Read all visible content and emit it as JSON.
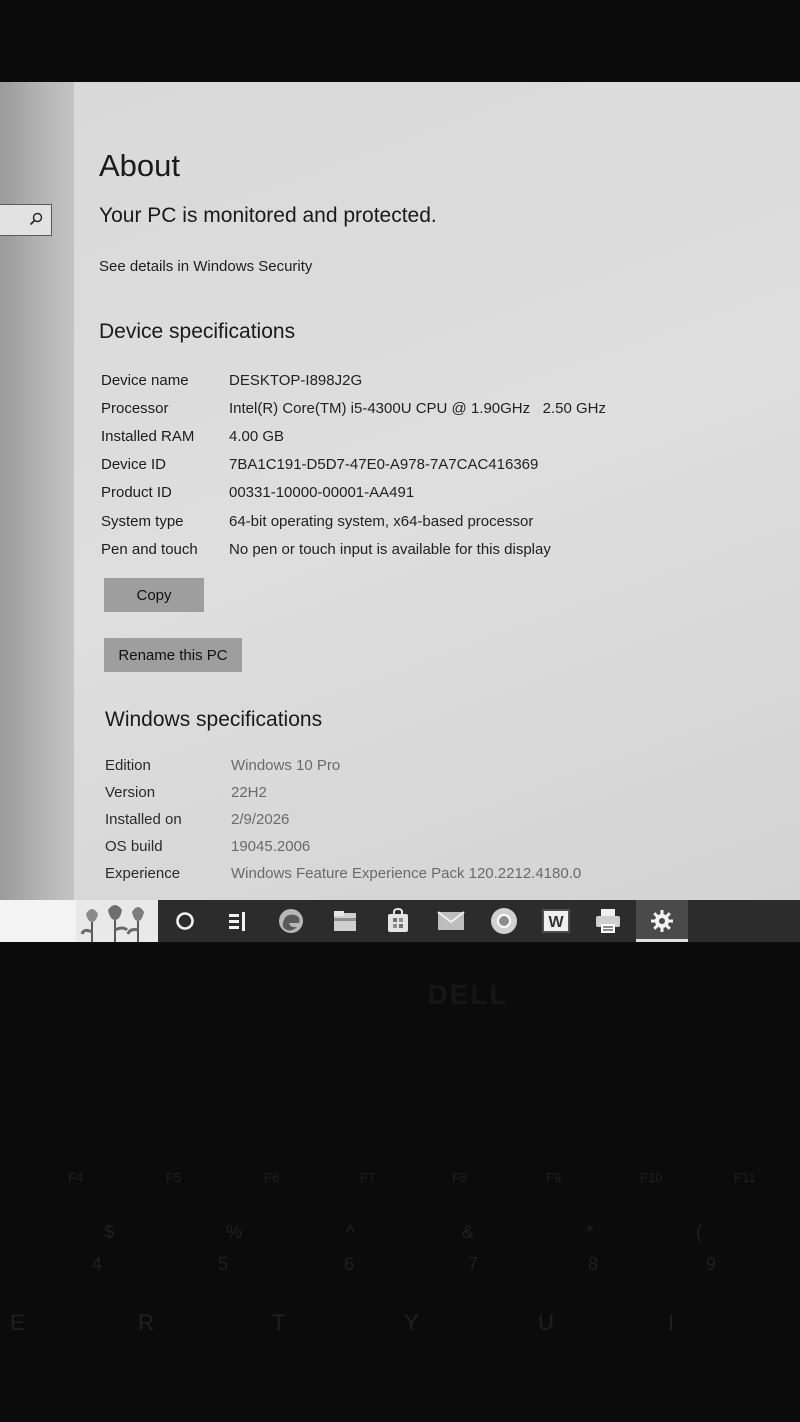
{
  "about": {
    "title": "About",
    "protection_status": "Your PC is monitored and protected.",
    "security_link": "See details in Windows Security"
  },
  "device_specs": {
    "heading": "Device specifications",
    "rows": [
      {
        "label": "Device name",
        "value": "DESKTOP-I898J2G"
      },
      {
        "label": "Processor",
        "value": "Intel(R) Core(TM) i5-4300U CPU @ 1.90GHz   2.50 GHz"
      },
      {
        "label": "Installed RAM",
        "value": "4.00 GB"
      },
      {
        "label": "Device ID",
        "value": "7BA1C191-D5D7-47E0-A978-7A7CAC416369"
      },
      {
        "label": "Product ID",
        "value": "00331-10000-00001-AA491"
      },
      {
        "label": "System type",
        "value": "64-bit operating system, x64-based processor"
      },
      {
        "label": "Pen and touch",
        "value": "No pen or touch input is available for this display"
      }
    ],
    "copy_label": "Copy",
    "rename_label": "Rename this PC"
  },
  "windows_specs": {
    "heading": "Windows specifications",
    "rows": [
      {
        "label": "Edition",
        "value": "Windows 10 Pro"
      },
      {
        "label": "Version",
        "value": "22H2"
      },
      {
        "label": "Installed on",
        "value": "2/9/2026"
      },
      {
        "label": "OS build",
        "value": "19045.2006"
      },
      {
        "label": "Experience",
        "value": "Windows Feature Experience Pack 120.2212.4180.0"
      }
    ]
  },
  "taskbar": {
    "icons": [
      "search-circle-icon",
      "task-view-icon",
      "edge-icon",
      "file-explorer-icon",
      "store-icon",
      "mail-icon",
      "chrome-icon",
      "wps-office-icon",
      "printer-icon",
      "settings-icon"
    ],
    "wps_letter": "W"
  },
  "keyboard": {
    "fkeys": [
      "F4",
      "F5",
      "F6",
      "F7",
      "F8",
      "F9",
      "F10",
      "F11"
    ],
    "symbols": [
      "$",
      "%",
      "^",
      "&",
      "*",
      "("
    ],
    "numbers": [
      "4",
      "5",
      "6",
      "7",
      "8",
      "9"
    ],
    "letters": [
      "E",
      "R",
      "T",
      "Y",
      "U",
      "I"
    ]
  },
  "colors": {
    "screen_bg": "#d9d9d9",
    "taskbar": "#2c2c2c",
    "button": "#9e9e9e"
  }
}
